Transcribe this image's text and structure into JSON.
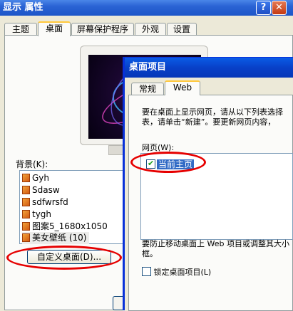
{
  "back_window": {
    "title": "显示 属性",
    "help_label": "?",
    "close_label": "✕",
    "tabs": [
      {
        "label": "主题"
      },
      {
        "label": "桌面"
      },
      {
        "label": "屏幕保护程序"
      },
      {
        "label": "外观"
      },
      {
        "label": "设置"
      }
    ],
    "background_label": "背景(K):",
    "backgrounds": [
      "Gyh",
      "Sdasw",
      "sdfwrsfd",
      "tygh",
      "图案5_1680x1050",
      "美女壁纸 (10)"
    ],
    "customize_button": "自定义桌面(D)..."
  },
  "front_dialog": {
    "title": "桌面项目",
    "tabs": [
      {
        "label": "常规"
      },
      {
        "label": "Web"
      }
    ],
    "intro_line1": "要在桌面上显示网页，请从以下列表选择",
    "intro_line2": "表，请单击“新建”。要更新网页内容，",
    "webpages_label": "网页(W):",
    "webpages": [
      {
        "label": "当前主页",
        "checked": true
      }
    ],
    "info_line1": "要防止移动桌面上 Web 项目或调整其大小",
    "info_line2": "框。",
    "lock_label": "锁定桌面项目(L)",
    "lock_checked": false
  },
  "colors": {
    "highlight_ellipse": "#e60000",
    "selection": "#316ac5",
    "title_bar": "#0a5ce6"
  }
}
